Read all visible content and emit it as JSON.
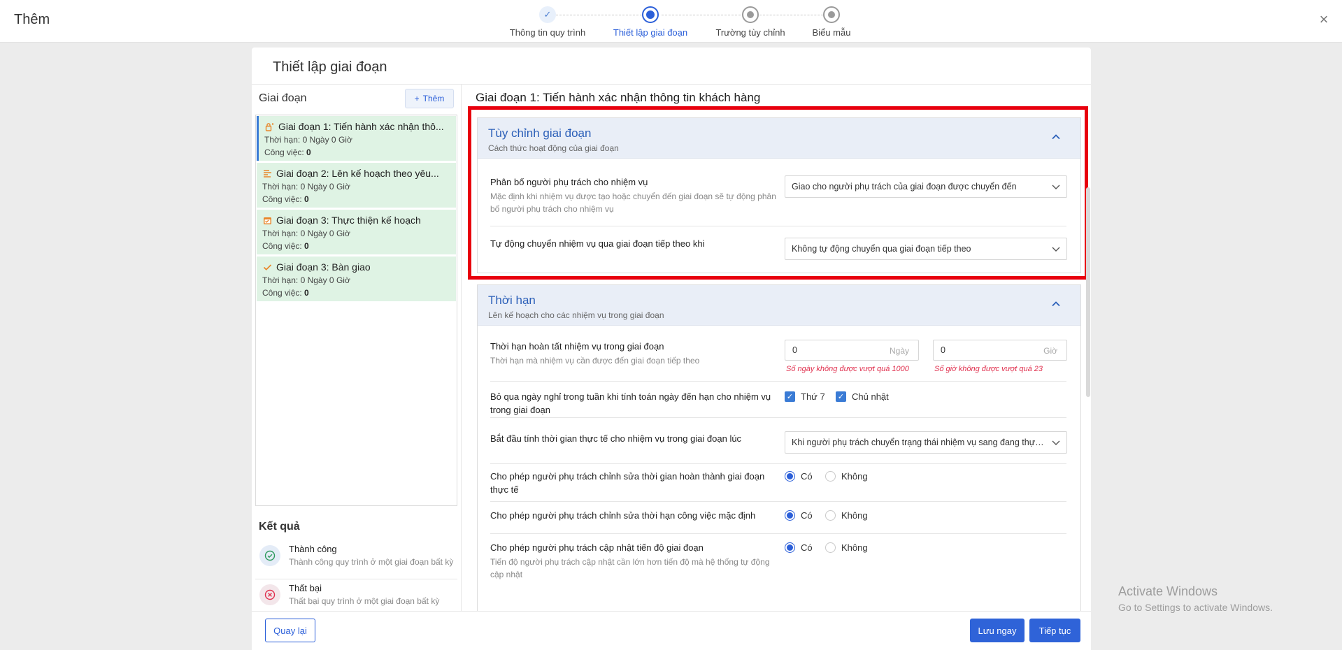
{
  "header": {
    "title": "Thêm",
    "close_label": "×"
  },
  "stepper": {
    "steps": [
      {
        "label": "Thông tin quy trình",
        "state": "done"
      },
      {
        "label": "Thiết lập giai đoạn",
        "state": "active"
      },
      {
        "label": "Trường tùy chỉnh",
        "state": "pending"
      },
      {
        "label": "Biểu mẫu",
        "state": "pending"
      }
    ]
  },
  "card": {
    "title": "Thiết lập giai đoạn"
  },
  "stages": {
    "heading": "Giai đoạn",
    "add_label": "Thêm",
    "items": [
      {
        "title": "Giai đoạn 1: Tiến hành xác nhận thô...",
        "deadline_label": "Thời hạn:",
        "deadline_value": "0 Ngày 0 Giờ",
        "task_label": "Công việc:",
        "task_value": "0",
        "icon": "lock-clock-icon"
      },
      {
        "title": "Giai đoạn 2: Lên kế hoạch theo yêu...",
        "deadline_label": "Thời hạn:",
        "deadline_value": "0 Ngày 0 Giờ",
        "task_label": "Công việc:",
        "task_value": "0",
        "icon": "list-lines-icon"
      },
      {
        "title": "Giai đoạn 3: Thực thiện kế hoạch",
        "deadline_label": "Thời hạn:",
        "deadline_value": "0 Ngày 0 Giờ",
        "task_label": "Công việc:",
        "task_value": "0",
        "icon": "calendar-icon"
      },
      {
        "title": "Giai đoạn 3: Bàn giao",
        "deadline_label": "Thời hạn:",
        "deadline_value": "0 Ngày 0 Giờ",
        "task_label": "Công việc:",
        "task_value": "0",
        "icon": "check-icon"
      }
    ]
  },
  "results": {
    "heading": "Kết quả",
    "items": [
      {
        "title": "Thành công",
        "desc": "Thành công quy trình ở một giai đoạn bất kỳ",
        "icon": "check-circle-icon",
        "color": "#2e9a5e"
      },
      {
        "title": "Thất bại",
        "desc": "Thất bại quy trình ở một giai đoạn bất kỳ",
        "icon": "x-circle-icon",
        "color": "#e0304e"
      }
    ]
  },
  "detail": {
    "title": "Giai đoạn 1: Tiến hành xác nhận thông tin khách hàng",
    "custom": {
      "heading": "Tùy chỉnh giai đoạn",
      "subheading": "Cách thức hoạt động của giai đoạn",
      "assign_label": "Phân bố người phụ trách cho nhiệm vụ",
      "assign_desc": "Mặc định khi nhiệm vụ được tạo hoặc chuyển đến giai đoạn sẽ tự động phân bố người phụ trách cho nhiệm vụ",
      "assign_value": "Giao cho người phụ trách của giai đoạn được chuyển đến",
      "auto_label": "Tự động chuyển nhiệm vụ qua giai đoạn tiếp theo khi",
      "auto_value": "Không tự động chuyển qua giai đoạn tiếp theo"
    },
    "deadline": {
      "heading": "Thời hạn",
      "subheading": "Lên kế hoạch cho các nhiệm vụ trong giai đoạn",
      "complete_label": "Thời hạn hoàn tất nhiệm vụ trong giai đoạn",
      "complete_desc": "Thời hạn mà nhiệm vụ cần được đến giai đoạn tiếp theo",
      "days_value": "0",
      "days_unit": "Ngày",
      "days_error": "Số ngày không được vượt quá 1000",
      "hours_value": "0",
      "hours_unit": "Giờ",
      "hours_error": "Số giờ không được vượt quá 23",
      "skip_label": "Bỏ qua ngày nghỉ trong tuần khi tính toán ngày đến hạn cho nhiệm vụ trong giai đoạn",
      "saturday_label": "Thứ 7",
      "sunday_label": "Chủ nhật",
      "start_label": "Bắt đầu tính thời gian thực tế cho nhiệm vụ trong giai đoạn lúc",
      "start_value": "Khi người phụ trách chuyển trạng thái nhiệm vụ sang đang thực hiện",
      "edit_complete_label": "Cho phép người phụ trách chỉnh sửa thời gian hoàn thành giai đoạn thực tế",
      "edit_default_label": "Cho phép người phụ trách chỉnh sửa thời hạn công việc mặc định",
      "update_progress_label": "Cho phép người phụ trách cập nhật tiến độ giai đoạn",
      "update_progress_desc": "Tiến độ người phụ trách cập nhật cần lớn hơn tiến độ mà hệ thống tự động cập nhật",
      "yes_label": "Có",
      "no_label": "Không"
    }
  },
  "footer": {
    "back_label": "Quay lại",
    "save_label": "Lưu ngay",
    "next_label": "Tiếp tục"
  },
  "watermark": {
    "line1": "Activate Windows",
    "line2": "Go to Settings to activate Windows."
  },
  "colors": {
    "primary": "#2f63d8",
    "stage_bg": "#dff3e4",
    "highlight": "#e8000d",
    "section_bg": "#e9eef7"
  }
}
